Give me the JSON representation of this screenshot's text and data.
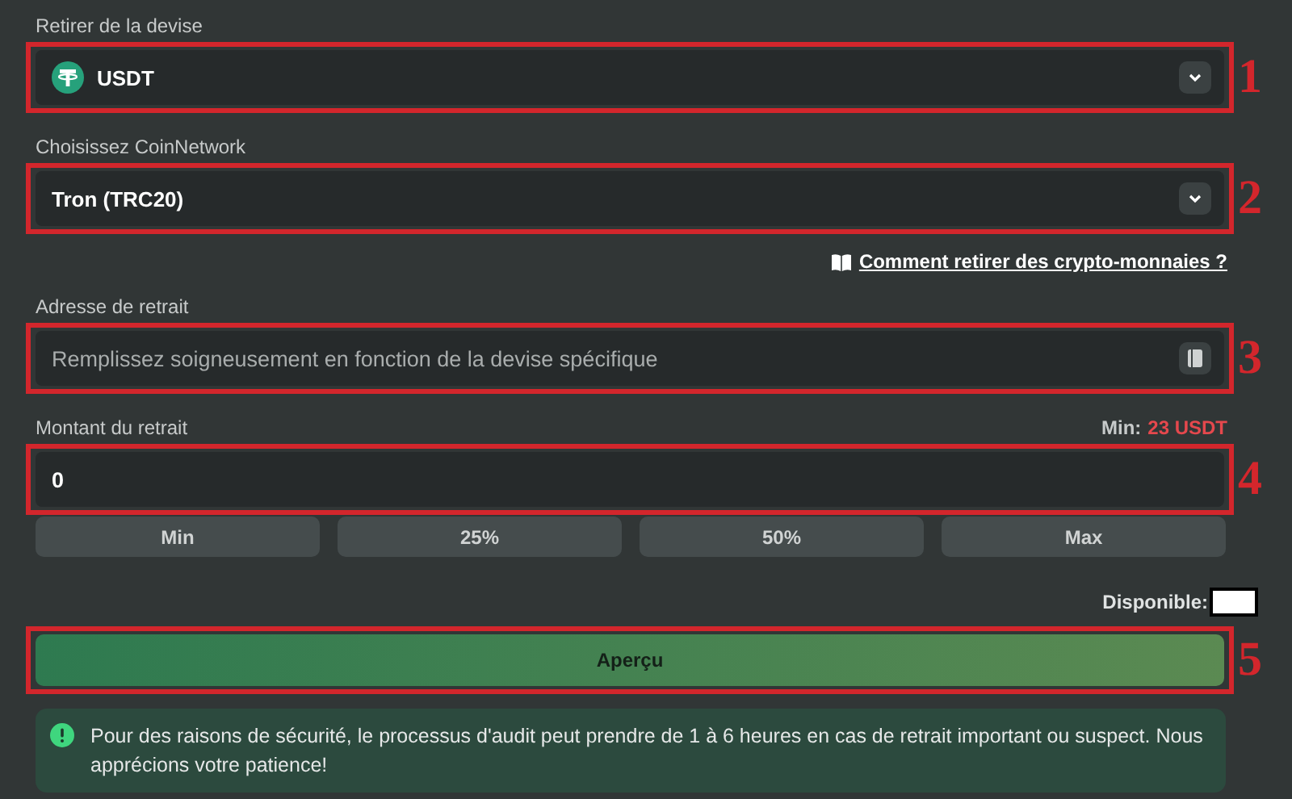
{
  "currency": {
    "label": "Retirer de la devise",
    "value": "USDT",
    "marker": "1"
  },
  "network": {
    "label": "Choisissez CoinNetwork",
    "value": "Tron (TRC20)",
    "marker": "2"
  },
  "help_link": {
    "text": "Comment retirer des crypto-monnaies ?"
  },
  "address": {
    "label": "Adresse de retrait",
    "placeholder": "Remplissez soigneusement en fonction de la devise spécifique",
    "marker": "3"
  },
  "amount": {
    "label": "Montant du retrait",
    "min_label": "Min:",
    "min_value": "23 USDT",
    "value": "0",
    "marker": "4"
  },
  "quick_amounts": [
    "Min",
    "25%",
    "50%",
    "Max"
  ],
  "available": {
    "label": "Disponible:"
  },
  "preview_button": {
    "label": "Aperçu",
    "marker": "5"
  },
  "notice": {
    "text": "Pour des raisons de sécurité, le processus d'audit peut prendre de 1 à 6 heures en cas de retrait important ou suspect. Nous apprécions votre patience!"
  }
}
